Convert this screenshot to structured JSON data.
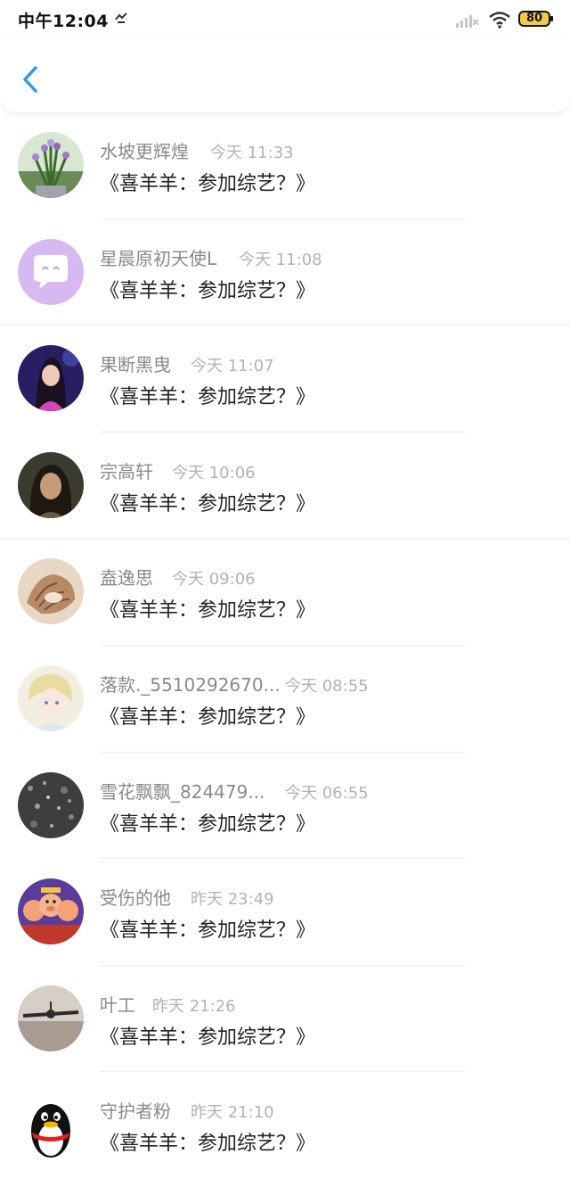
{
  "status_bar": {
    "time": "中午12:04",
    "battery": "80"
  },
  "messages": [
    {
      "name": "水坡更辉煌",
      "time": "今天 11:33",
      "text": "《喜羊羊：参加综艺？》",
      "avatar_icon": "flower-photo-avatar"
    },
    {
      "name": "星晨原初天使L",
      "time": "今天 11:08",
      "text": "《喜羊羊：参加综艺？》",
      "avatar_icon": "chat-bubble-avatar"
    },
    {
      "name": "果断黑曳",
      "time": "今天 11:07",
      "text": "《喜羊羊：参加综艺？》",
      "avatar_icon": "girl-photo-avatar"
    },
    {
      "name": "宗高轩",
      "time": "今天 10:06",
      "text": "《喜羊羊：参加综艺？》",
      "avatar_icon": "girl-portrait-avatar"
    },
    {
      "name": "盍逸思",
      "time": "今天 09:06",
      "text": "《喜羊羊：参加综艺？》",
      "avatar_icon": "seashell-avatar"
    },
    {
      "name": "落款._5510292670...",
      "time": "今天 08:55",
      "text": "《喜羊羊：参加综艺？》",
      "avatar_icon": "anime-boy-avatar"
    },
    {
      "name": "雪花飘飘_824479...",
      "time": "今天 06:55",
      "text": "《喜羊羊：参加综艺？》",
      "avatar_icon": "stone-texture-avatar"
    },
    {
      "name": "受伤的他",
      "time": "昨天 23:49",
      "text": "《喜羊羊：参加综艺？》",
      "avatar_icon": "cartoon-pigs-avatar"
    },
    {
      "name": "叶工",
      "time": "昨天 21:26",
      "text": "《喜羊羊：参加综艺？》",
      "avatar_icon": "ceiling-fan-avatar"
    },
    {
      "name": "守护者粉",
      "time": "昨天 21:10",
      "text": "《喜羊羊：参加综艺？》",
      "avatar_icon": "qq-penguin-avatar"
    }
  ]
}
